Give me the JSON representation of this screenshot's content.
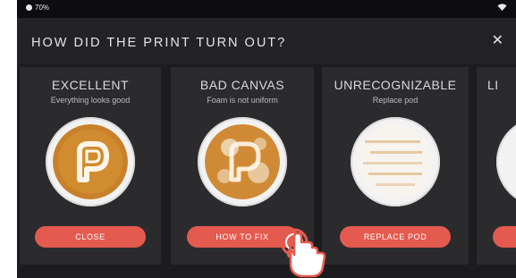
{
  "status": {
    "battery": "70%"
  },
  "header": {
    "title": "HOW DID THE PRINT TURN OUT?"
  },
  "cards": [
    {
      "title": "EXCELLENT",
      "subtitle": "Everything looks good",
      "button": "CLOSE"
    },
    {
      "title": "BAD CANVAS",
      "subtitle": "Foam is not uniform",
      "button": "HOW TO FIX"
    },
    {
      "title": "UNRECOGNIZABLE",
      "subtitle": "Replace pod",
      "button": "REPLACE POD"
    },
    {
      "title": "LI"
    }
  ],
  "colors": {
    "accent": "#e55a4e",
    "background": "#1c1c1f",
    "card": "#2b2b2e"
  },
  "icons": {
    "close": "close-icon",
    "wifi": "wifi-icon",
    "battery": "battery-icon"
  }
}
